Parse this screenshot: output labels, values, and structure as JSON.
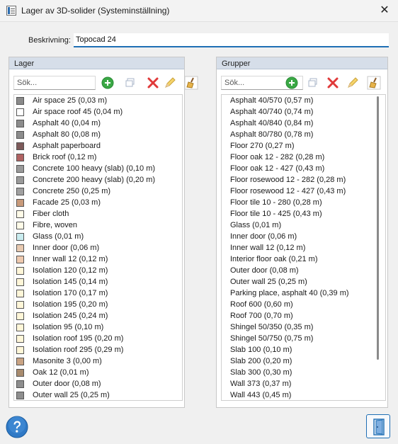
{
  "window": {
    "title": "Lager av 3D-solider (Systeminställning)",
    "close_glyph": "✕"
  },
  "description": {
    "label": "Beskrivning:",
    "value": "Topocad 24"
  },
  "layers_panel": {
    "header": "Lager",
    "search_placeholder": "Sök...",
    "items": [
      {
        "label": "Air space 25 (0,03 m)",
        "color": "#8a8a8a"
      },
      {
        "label": "Air space roof 45 (0,04 m)",
        "color": "#ffffff"
      },
      {
        "label": "Asphalt 40 (0,04 m)",
        "color": "#8c8c8c"
      },
      {
        "label": "Asphalt 80 (0,08 m)",
        "color": "#8c8c8c"
      },
      {
        "label": "Asphalt paperboard",
        "color": "#7d5a5a"
      },
      {
        "label": "Brick roof (0,12 m)",
        "color": "#b06262"
      },
      {
        "label": "Concrete 100 heavy (slab) (0,10 m)",
        "color": "#9a9a9a"
      },
      {
        "label": "Concrete 200 heavy (slab) (0,20 m)",
        "color": "#9a9a9a"
      },
      {
        "label": "Concrete 250 (0,25 m)",
        "color": "#a0a0a0"
      },
      {
        "label": "Facade 25 (0,03 m)",
        "color": "#c89a7a"
      },
      {
        "label": "Fiber cloth",
        "color": "#fffbe8"
      },
      {
        "label": "Fibre, woven",
        "color": "#fffbe8"
      },
      {
        "label": "Glass (0,01 m)",
        "color": "#c9ecef"
      },
      {
        "label": "Inner door (0,06 m)",
        "color": "#e8c9b0"
      },
      {
        "label": "Inner wall 12 (0,12 m)",
        "color": "#eec9ae"
      },
      {
        "label": "Isolation 120 (0,12 m)",
        "color": "#fff6d8"
      },
      {
        "label": "Isolation 145 (0,14 m)",
        "color": "#fff6d8"
      },
      {
        "label": "Isolation 170 (0,17 m)",
        "color": "#fff6d8"
      },
      {
        "label": "Isolation 195 (0,20 m)",
        "color": "#fff6d8"
      },
      {
        "label": "Isolation 245 (0,24 m)",
        "color": "#fff6d8"
      },
      {
        "label": "Isolation 95 (0,10 m)",
        "color": "#fff6d8"
      },
      {
        "label": "Isolation roof 195 (0,20 m)",
        "color": "#fff6d8"
      },
      {
        "label": "Isolation roof 295 (0,29 m)",
        "color": "#fff6d8"
      },
      {
        "label": "Masonite 3 (0,00 m)",
        "color": "#c9a383"
      },
      {
        "label": "Oak 12 (0,01 m)",
        "color": "#a88b6e"
      },
      {
        "label": "Outer door (0,08 m)",
        "color": "#8e8e8e"
      },
      {
        "label": "Outer wall 25 (0,25 m)",
        "color": "#8e8e8e"
      }
    ]
  },
  "groups_panel": {
    "header": "Grupper",
    "search_placeholder": "Sök...",
    "items": [
      "Asphalt 40/570 (0,57 m)",
      "Asphalt 40/740 (0,74 m)",
      "Asphalt 40/840 (0,84 m)",
      "Asphalt 80/780 (0,78 m)",
      "Floor 270 (0,27 m)",
      "Floor oak 12 - 282 (0,28 m)",
      "Floor oak 12 - 427 (0,43 m)",
      "Floor rosewood 12 - 282 (0,28 m)",
      "Floor rosewood 12 - 427 (0,43 m)",
      "Floor tile 10 - 280 (0,28 m)",
      "Floor tile 10 - 425 (0,43 m)",
      "Glass (0,01 m)",
      "Inner door (0,06 m)",
      "Inner wall 12 (0,12 m)",
      "Interior floor oak (0,21 m)",
      "Outer door (0,08 m)",
      "Outer wall 25 (0,25 m)",
      "Parking place, asphalt 40 (0,39 m)",
      "Roof 600 (0,60 m)",
      "Roof 700 (0,70 m)",
      "Shingel 50/350 (0,35 m)",
      "Shingel 50/750 (0,75 m)",
      "Slab 100 (0,10 m)",
      "Slab 200 (0,20 m)",
      "Slab 300 (0,30 m)",
      "Wall 373 (0,37 m)",
      "Wall 443 (0,45 m)"
    ]
  },
  "toolbar_icons": [
    "add-icon",
    "copy-icon",
    "delete-icon",
    "edit-icon",
    "clean-icon"
  ],
  "colors": {
    "accent": "#1f6fb5",
    "panel_header": "#d6dee9",
    "add_green": "#3aa845",
    "delete_red": "#e03a3a"
  }
}
